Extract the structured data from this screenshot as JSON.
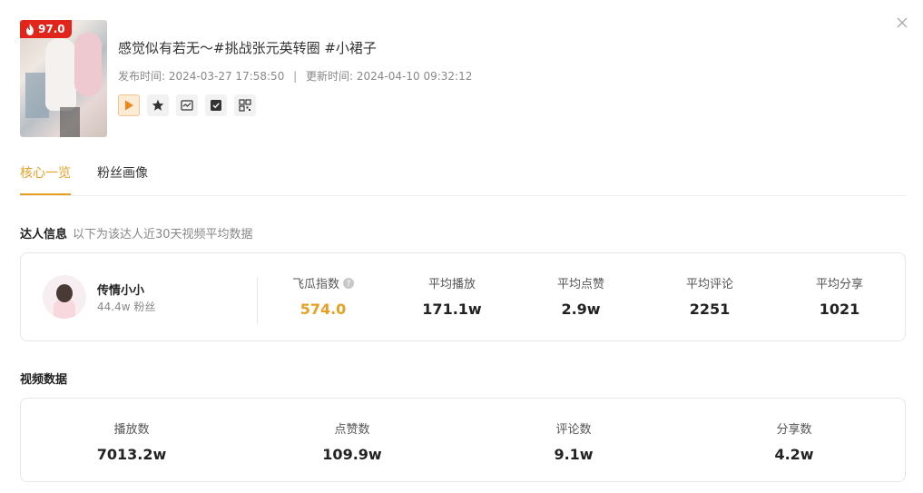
{
  "video": {
    "heat_score": "97.0",
    "title": "感觉似有若无～#挑战张元英转圈 #小裙子",
    "publish_label": "发布时间:",
    "publish_time": "2024-03-27 17:58:50",
    "separator": "|",
    "update_label": "更新时间:",
    "update_time": "2024-04-10 09:32:12"
  },
  "tabs": [
    {
      "label": "核心一览",
      "active": true
    },
    {
      "label": "粉丝画像",
      "active": false
    }
  ],
  "influencer_section": {
    "title": "达人信息",
    "subtitle": "以下为该达人近30天视频平均数据"
  },
  "influencer": {
    "name": "传情小小",
    "fans": "44.4w 粉丝"
  },
  "influencer_stats": [
    {
      "label": "飞瓜指数",
      "value": "574.0",
      "highlight": true,
      "help": true
    },
    {
      "label": "平均播放",
      "value": "171.1w"
    },
    {
      "label": "平均点赞",
      "value": "2.9w"
    },
    {
      "label": "平均评论",
      "value": "2251"
    },
    {
      "label": "平均分享",
      "value": "1021"
    }
  ],
  "video_section": {
    "title": "视频数据"
  },
  "video_stats": [
    {
      "label": "播放数",
      "value": "7013.2w"
    },
    {
      "label": "点赞数",
      "value": "109.9w"
    },
    {
      "label": "评论数",
      "value": "9.1w"
    },
    {
      "label": "分享数",
      "value": "4.2w"
    }
  ],
  "colors": {
    "accent": "#e8a024",
    "badge_red": "#e1251b"
  },
  "icons": {
    "action_buttons": [
      "play-icon",
      "star-icon",
      "trend-icon",
      "check-icon",
      "qrcode-icon"
    ]
  }
}
